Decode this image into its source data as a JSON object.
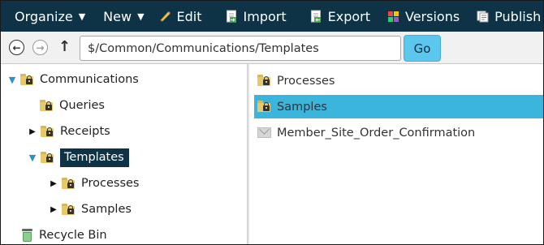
{
  "toolbar": {
    "organize": "Organize",
    "new": "New",
    "edit": "Edit",
    "import": "Import",
    "export": "Export",
    "versions": "Versions",
    "publish": "Publish"
  },
  "address": {
    "path": "$/Common/Communications/Templates",
    "go_label": "Go"
  },
  "tree": {
    "root": "Communications",
    "queries": "Queries",
    "receipts": "Receipts",
    "templates": "Templates",
    "processes": "Processes",
    "samples": "Samples",
    "recycle_bin": "Recycle Bin"
  },
  "list": {
    "items": [
      {
        "label": "Processes",
        "type": "folder"
      },
      {
        "label": "Samples",
        "type": "folder",
        "selected": true
      },
      {
        "label": "Member_Site_Order_Confirmation",
        "type": "email-template"
      }
    ]
  },
  "colors": {
    "toolbar_bg": "#0e3246",
    "selection": "#3bb5dc",
    "go_button": "#5bc6ee",
    "folder": "#e8c96a"
  }
}
